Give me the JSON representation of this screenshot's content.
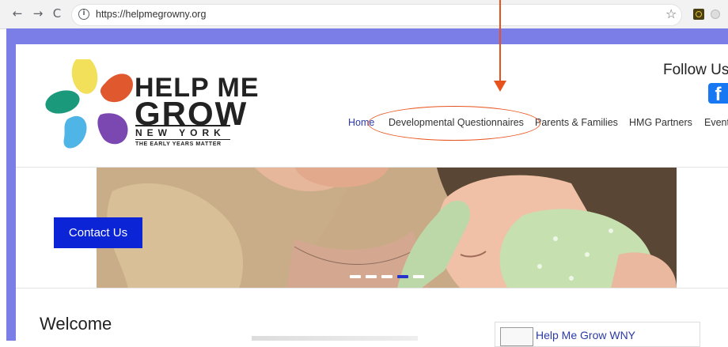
{
  "browser": {
    "url": "https://helpmegrowny.org",
    "back_icon": "←",
    "forward_icon": "→",
    "reload_icon": "C",
    "info_icon": "i",
    "bookmark_icon": "☆"
  },
  "header": {
    "brand_line1": "HELP ME",
    "brand_line2": "GROW",
    "brand_line3": "NEW YORK",
    "tagline": "THE EARLY YEARS MATTER",
    "follow_us": "Follow Us",
    "facebook_icon": "f"
  },
  "nav": {
    "items": [
      "Home",
      "Developmental Questionnaires",
      "Parents & Families",
      "HMG Partners",
      "Event"
    ]
  },
  "hero": {
    "cta_label": "Contact Us",
    "slide_count": 5,
    "active_slide": 4
  },
  "content": {
    "heading": "Welcome"
  },
  "widget": {
    "title": "Help Me Grow WNY"
  },
  "colors": {
    "frame": "#7c7ee8",
    "cta": "#0b24d6",
    "annotation": "#e8521e",
    "nav_active": "#2b3aa8"
  }
}
